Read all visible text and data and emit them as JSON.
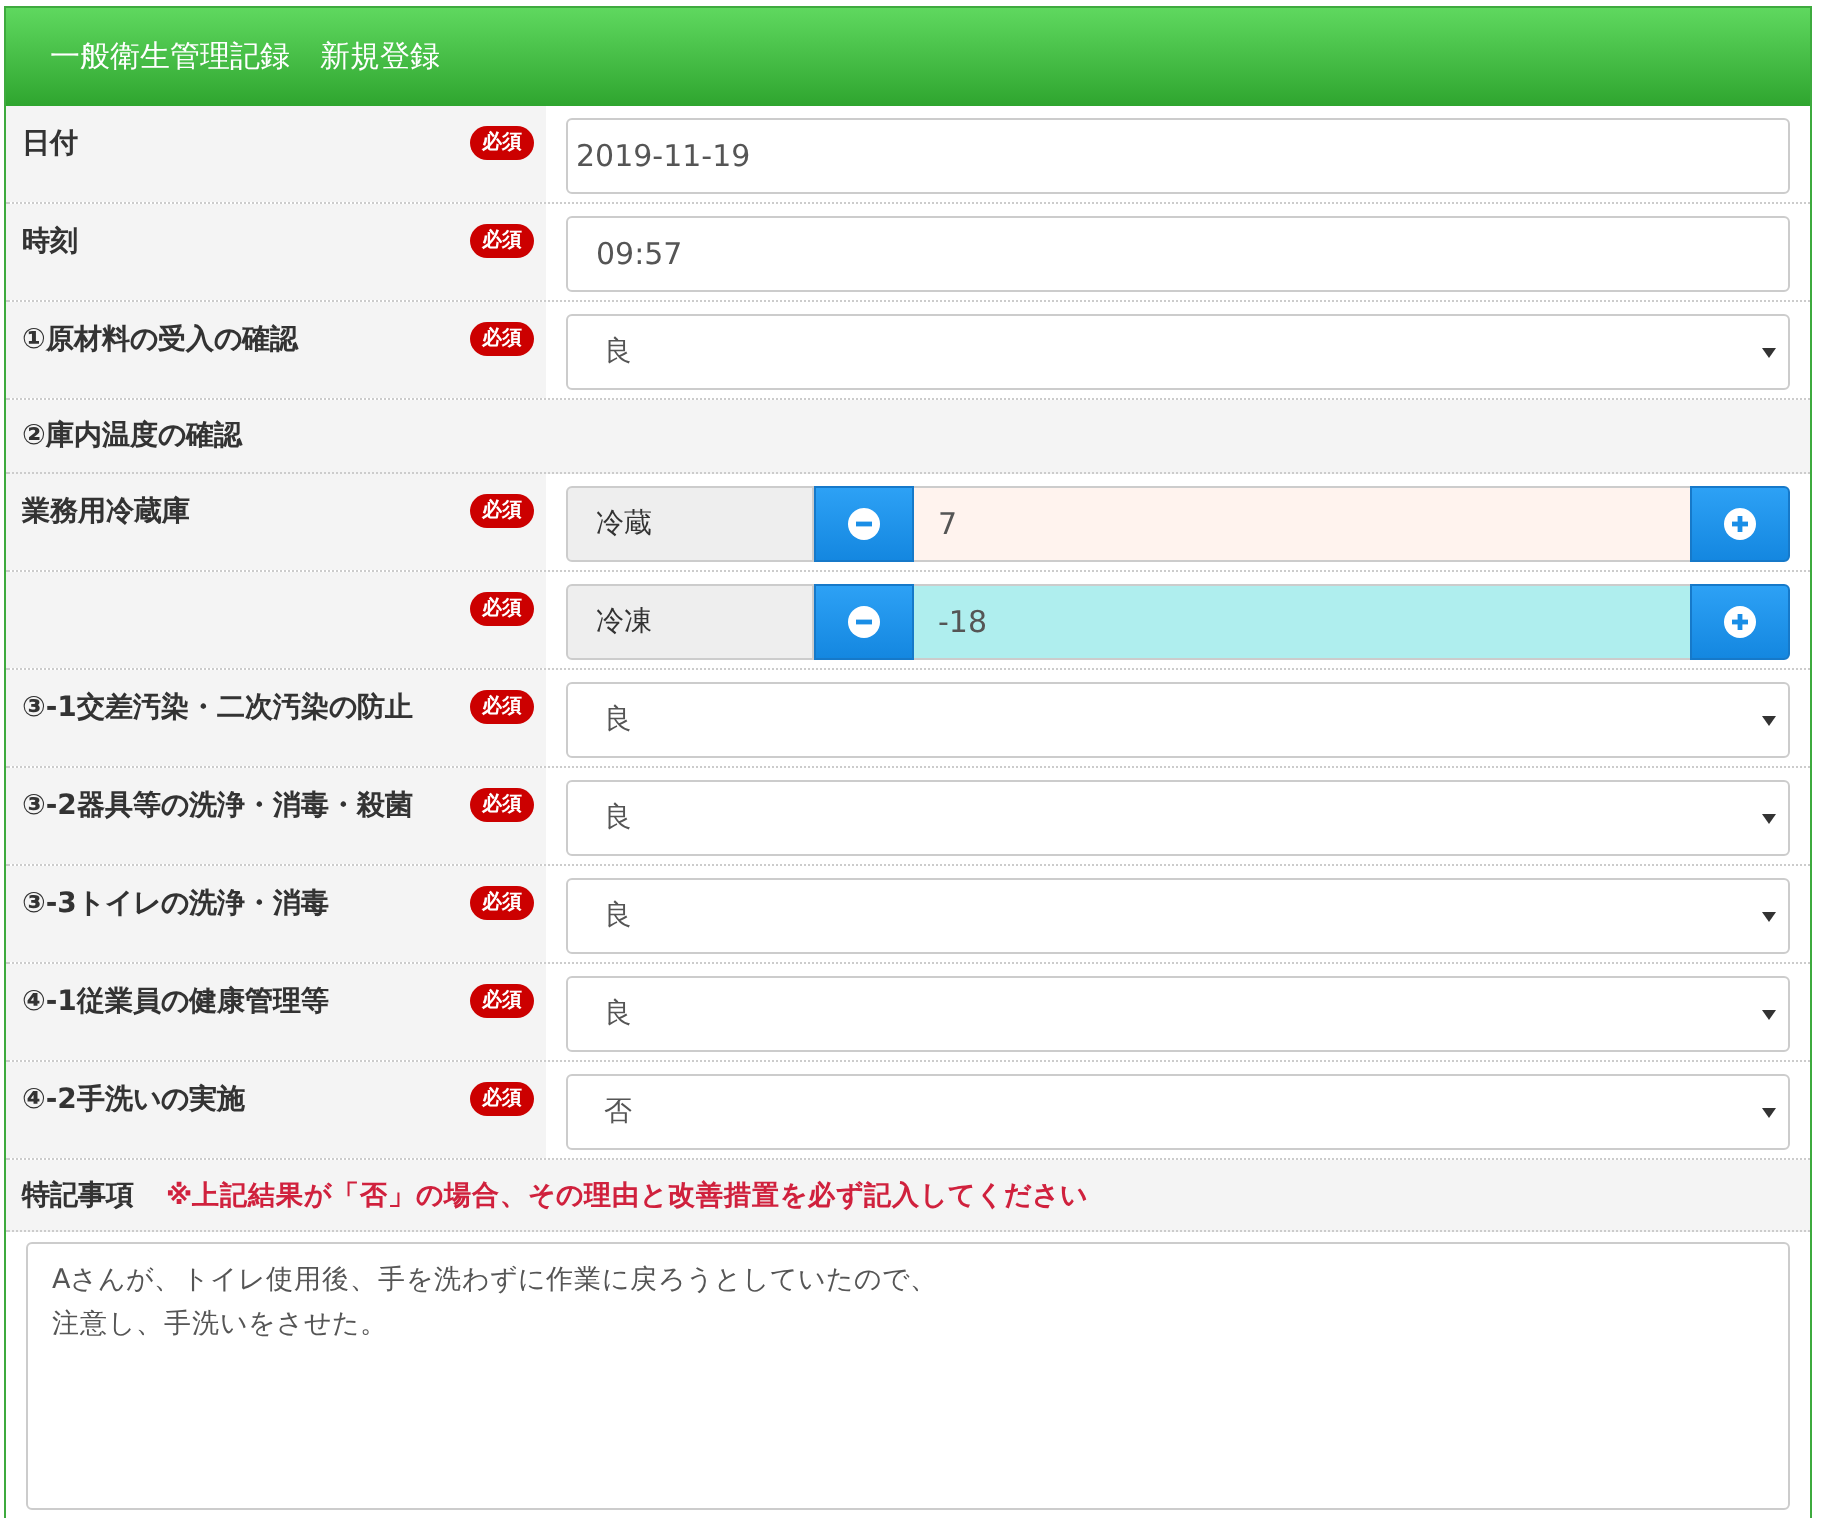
{
  "header": {
    "title": "一般衛生管理記録　新規登録"
  },
  "rows": [
    {
      "kind": "text",
      "label": "日付",
      "badge": "必須",
      "value": "2019-11-19"
    },
    {
      "kind": "text",
      "label": "時刻",
      "badge": "必須",
      "value": "09:57"
    },
    {
      "kind": "select",
      "label": "①原材料の受入の確認",
      "badge": "必須",
      "value": "良"
    },
    {
      "kind": "section",
      "label": "②庫内温度の確認"
    },
    {
      "kind": "stepper",
      "label": "業務用冷蔵庫",
      "badge": "必須",
      "addon": "冷蔵",
      "value": "7",
      "color": "#fff3ee"
    },
    {
      "kind": "stepper",
      "badge": "必須",
      "addon": "冷凍",
      "value": "-18",
      "color": "#afeeee"
    },
    {
      "kind": "select",
      "label": "③-1交差汚染・二次汚染の防止",
      "badge": "必須",
      "value": "良"
    },
    {
      "kind": "select",
      "label": "③-2器具等の洗浄・消毒・殺菌",
      "badge": "必須",
      "value": "良"
    },
    {
      "kind": "select",
      "label": "③-3トイレの洗浄・消毒",
      "badge": "必須",
      "value": "良"
    },
    {
      "kind": "select",
      "label": "④-1従業員の健康管理等",
      "badge": "必須",
      "value": "良"
    },
    {
      "kind": "select",
      "label": "④-2手洗いの実施",
      "badge": "必須",
      "value": "否"
    }
  ],
  "remarks": {
    "label": "特記事項",
    "note": "※上記結果が「否」の場合、その理由と改善措置を必ず記入してください",
    "lines": [
      "Aさんが、トイレ使用後、手を洗わずに作業に戻ろうとしていたので、",
      "注意し、手洗いをさせた。"
    ]
  }
}
